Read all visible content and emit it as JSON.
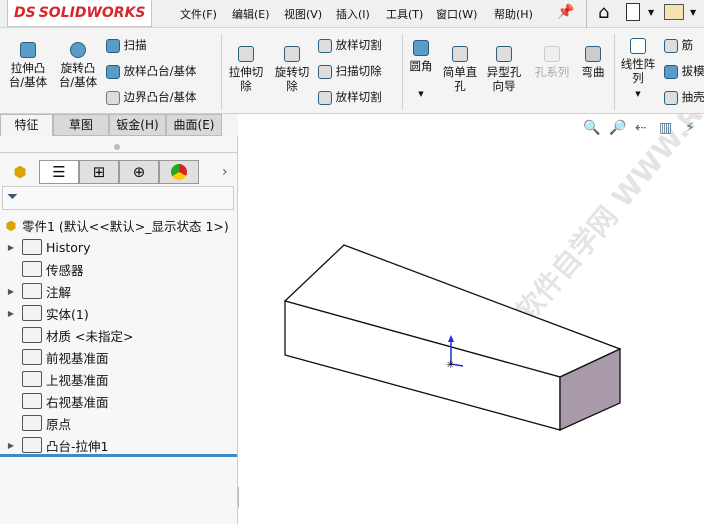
{
  "app": {
    "logo": "SOLIDWORKS",
    "logo_mark": "DS"
  },
  "menu": [
    "文件(F)",
    "编辑(E)",
    "视图(V)",
    "插入(I)",
    "工具(T)",
    "窗口(W)",
    "帮助(H)"
  ],
  "ribbon": {
    "extrude_boss": "拉伸凸台/基体",
    "revolve_boss": "旋转凸台/基体",
    "sweep": "扫描",
    "loft_boss": "放样凸台/基体",
    "boundary_boss": "边界凸台/基体",
    "extrude_cut": "拉伸切除",
    "revolve_cut": "旋转切除",
    "loft_cut": "放样切割",
    "sweep_cut": "扫描切除",
    "boundary_cut": "放样切割",
    "fillet": "圆角",
    "simple_hole": "简单直孔",
    "hole_wizard": "异型孔向导",
    "hole_series": "孔系列",
    "flex": "弯曲",
    "linear_pattern": "线性阵列",
    "rib": "筋",
    "draft": "拔模",
    "shell": "抽壳"
  },
  "tabs": [
    "特征",
    "草图",
    "钣金(H)",
    "曲面(E)"
  ],
  "tree": {
    "root": "零件1  (默认<<默认>_显示状态 1>)",
    "items": [
      {
        "label": "History",
        "icon": "history-folder-icon",
        "expand": true
      },
      {
        "label": "传感器",
        "icon": "sensor-folder-icon",
        "expand": false
      },
      {
        "label": "注解",
        "icon": "annotation-folder-icon",
        "expand": true
      },
      {
        "label": "实体(1)",
        "icon": "solid-body-folder-icon",
        "expand": true
      },
      {
        "label": "材质 <未指定>",
        "icon": "material-icon",
        "expand": false
      },
      {
        "label": "前视基准面",
        "icon": "plane-icon",
        "expand": false
      },
      {
        "label": "上视基准面",
        "icon": "plane-icon",
        "expand": false
      },
      {
        "label": "右视基准面",
        "icon": "plane-icon",
        "expand": false
      },
      {
        "label": "原点",
        "icon": "origin-icon",
        "expand": false
      },
      {
        "label": "凸台-拉伸1",
        "icon": "extrude-feature-icon",
        "expand": true
      }
    ]
  },
  "watermark": "软件自学网 WWW.RJZXW.COM",
  "colors": {
    "accent": "#3d8bc4",
    "side_face": "#a89aa8",
    "logo_red": "#d9262c"
  }
}
